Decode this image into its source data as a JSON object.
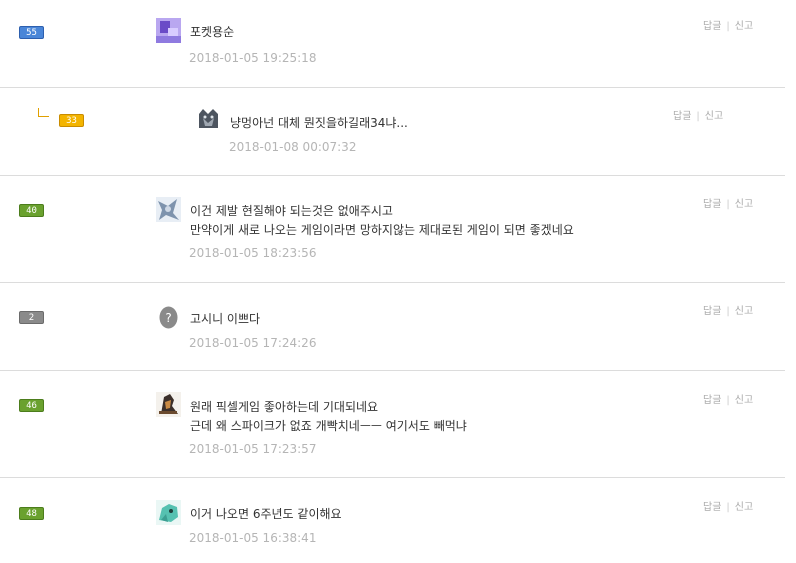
{
  "actions": {
    "reply": "답글",
    "report": "신고"
  },
  "comments": [
    {
      "level": "55",
      "name": "포켓용순",
      "lines": [
        "포켓용순"
      ],
      "time": "2018-01-05 19:25:18"
    },
    {
      "level": "33",
      "lines": [
        "냥멍아넌 대체 뭔짓을하길래34냐..."
      ],
      "time": "2018-01-08 00:07:32"
    },
    {
      "level": "40",
      "lines": [
        "이건 제발 현질해야 되는것은 없애주시고",
        "만약이게 새로 나오는 게임이라면 망하지않는 제대로된 게임이 되면 좋겠네요"
      ],
      "time": "2018-01-05 18:23:56"
    },
    {
      "level": "2",
      "lines": [
        "고시니 이쁘다"
      ],
      "time": "2018-01-05 17:24:26"
    },
    {
      "level": "46",
      "lines": [
        "원래 픽셀게임 좋아하는데 기대되네요",
        "근데 왜 스파이크가 없죠 개빡치네ㅡㅡ 여기서도 빼먹냐"
      ],
      "time": "2018-01-05 17:23:57"
    },
    {
      "level": "48",
      "lines": [
        "이거 나오면 6주년도 같이해요"
      ],
      "time": "2018-01-05 16:38:41"
    }
  ]
}
